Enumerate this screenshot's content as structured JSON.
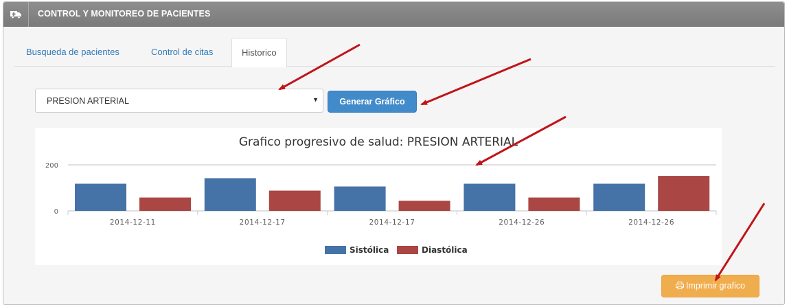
{
  "panel": {
    "title": "CONTROL Y MONITOREO DE PACIENTES",
    "icon": "ambulance-icon"
  },
  "tabs": [
    {
      "label": "Busqueda de pacientes",
      "active": false
    },
    {
      "label": "Control de citas",
      "active": false
    },
    {
      "label": "Historico",
      "active": true
    }
  ],
  "form": {
    "select_value": "PRESION ARTERIAL",
    "generate_button": "Generar Gráfico"
  },
  "print_button": {
    "label": "Imprimir grafico",
    "icon": "print-icon"
  },
  "colors": {
    "sistolica": "#4572a7",
    "diastolica": "#aa4643",
    "arrow": "#c0141a"
  },
  "chart_data": {
    "type": "bar",
    "title": "Grafico progresivo de salud: PRESION ARTERIAL",
    "categories": [
      "2014-12-11",
      "2014-12-17",
      "2014-12-17",
      "2014-12-26",
      "2014-12-26"
    ],
    "series": [
      {
        "name": "Sistólica",
        "values": [
          118,
          142,
          106,
          118,
          118
        ]
      },
      {
        "name": "Diastólica",
        "values": [
          58,
          88,
          44,
          58,
          152
        ]
      }
    ],
    "y_ticks": [
      "0",
      "200"
    ],
    "ylim": [
      0,
      200
    ],
    "grid": true,
    "legend": "bottom-center"
  }
}
